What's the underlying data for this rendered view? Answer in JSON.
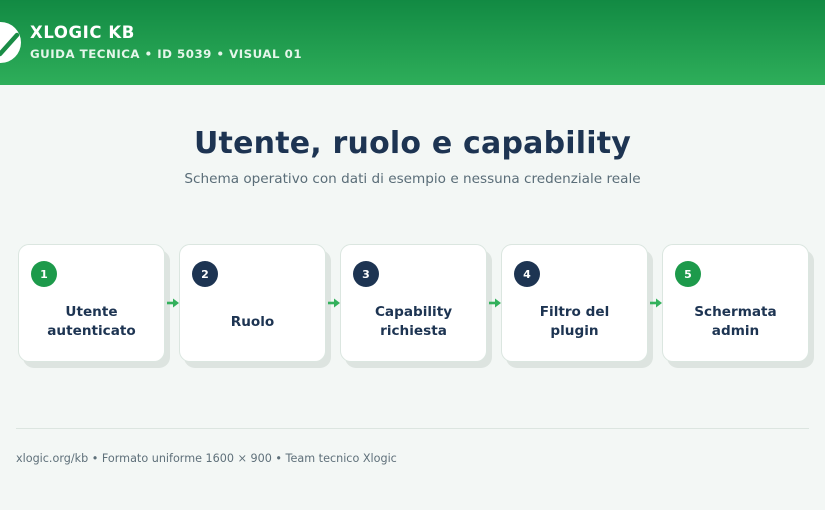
{
  "header": {
    "brand": "XLOGIC KB",
    "subtitle": "GUIDA TECNICA • ID 5039 • VISUAL 01",
    "logo_icon": "check-icon"
  },
  "main": {
    "title": "Utente, ruolo e capability",
    "subtitle": "Schema operativo con dati di esempio e nessuna credenziale reale"
  },
  "steps": [
    {
      "number": "1",
      "label": "Utente\nautenticato",
      "badge_color": "#1d9a4b"
    },
    {
      "number": "2",
      "label": "Ruolo",
      "badge_color": "#1d3452"
    },
    {
      "number": "3",
      "label": "Capability\nrichiesta",
      "badge_color": "#1d3452"
    },
    {
      "number": "4",
      "label": "Filtro del\nplugin",
      "badge_color": "#1d3452"
    },
    {
      "number": "5",
      "label": "Schermata\nadmin",
      "badge_color": "#1d9a4b"
    }
  ],
  "colors": {
    "accent": "#1d9a4b",
    "navy": "#1d3452",
    "arrow": "#33b15c"
  },
  "footer": {
    "text": "xlogic.org/kb • Formato uniforme 1600 × 900 • Team tecnico Xlogic"
  }
}
